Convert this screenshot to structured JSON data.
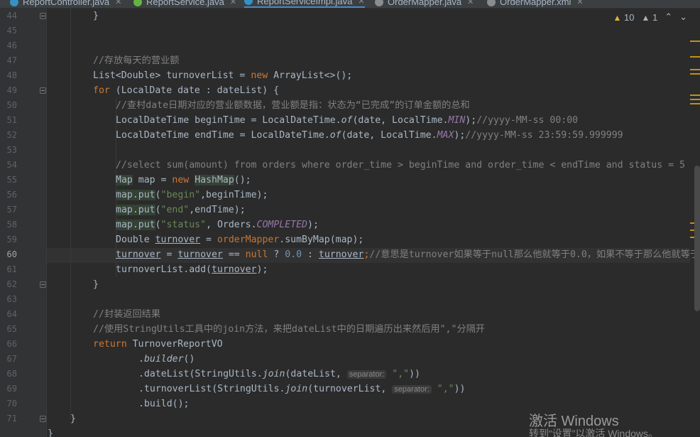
{
  "tabs": [
    {
      "label": "ReportController.java",
      "icon_color": "#3592c4"
    },
    {
      "label": "ReportService.java",
      "icon_color": "#62b543"
    },
    {
      "label": "ReportServiceImpl.java",
      "icon_color": "#3592c4",
      "active": true
    },
    {
      "label": "OrderMapper.java",
      "icon_color": "#8c8c8c"
    },
    {
      "label": "OrderMapper.xml",
      "icon_color": "#8c8c8c"
    }
  ],
  "inspections": {
    "warnings": "10",
    "weak_warnings": "1"
  },
  "line_numbers": [
    "44",
    "45",
    "46",
    "47",
    "48",
    "49",
    "50",
    "51",
    "52",
    "53",
    "54",
    "55",
    "56",
    "57",
    "58",
    "59",
    "60",
    "61",
    "62",
    "63",
    "64",
    "65",
    "66",
    "67",
    "68",
    "69",
    "70",
    "71"
  ],
  "current_line": "60",
  "code": {
    "l44_brace": "}",
    "l47_comment": "//存放每天的营业额",
    "l48_a": "List<Double> turnoverList = ",
    "l48_new": "new",
    "l48_b": " ArrayList<>();",
    "l49_for": "for",
    "l49_b": " (LocalDate date : dateList) {",
    "l50_comment": "//查村date日期对应的营业额数据，营业额是指：状态为“已完成”的订单金额的总和",
    "l51_a": "LocalDateTime beginTime = LocalDateTime.",
    "l51_of": "of",
    "l51_b": "(date, LocalTime.",
    "l51_min": "MIN",
    "l51_c": ");",
    "l51_cm": "//yyyy-MM-ss 00:00",
    "l52_a": "LocalDateTime endTime = LocalDateTime.",
    "l52_of": "of",
    "l52_b": "(date, LocalTime.",
    "l52_max": "MAX",
    "l52_c": ");",
    "l52_cm": "//yyyy-MM-ss 23:59:59.999999",
    "l54_comment": "//select sum(amount) from orders where order_time > beginTime and order_time < endTime and status = 5",
    "l55_map": "Map",
    "l55_a": " map = ",
    "l55_new": "new",
    "l55_sp": " ",
    "l55_hashmap": "HashMap",
    "l55_b": "();",
    "l56_put": "map.put",
    "l56_a": "(",
    "l56_str": "\"begin\"",
    "l56_b": ",beginTime);",
    "l57_put": "map.put",
    "l57_a": "(",
    "l57_str": "\"end\"",
    "l57_b": ",endTime);",
    "l58_put": "map.put",
    "l58_a": "(",
    "l58_str": "\"status\"",
    "l58_b": ", Orders.",
    "l58_completed": "COMPLETED",
    "l58_c": ");",
    "l59_a": "Double ",
    "l59_turnover": "turnover",
    "l59_b": " = ",
    "l59_mapper": "orderMapper",
    "l59_c": ".sumByMap(map);",
    "l60_t1": "turnover",
    "l60_a": " = ",
    "l60_t2": "turnover",
    "l60_b": " == ",
    "l60_null": "null",
    "l60_c": " ? ",
    "l60_zero": "0.0",
    "l60_d": " : ",
    "l60_t3": "turnover",
    "l60_semi": ";",
    "l60_cm": "//意思是turnover如果等于null那么他就等于0.0，如果不等于那么他就等于",
    "l61_a": "turnoverList.add(",
    "l61_turnover": "turnover",
    "l61_b": ");",
    "l62_brace": "}",
    "l64_comment": "//封装返回结果",
    "l65_comment": "//使用StringUtils工具中的join方法，来把dateList中的日期遍历出来然后用\",\"分隔开",
    "l66_return": "return",
    "l66_b": " TurnoverReportVO",
    "l67_dot": ".",
    "l67_builder": "builder",
    "l67_b": "()",
    "l68_a": ".dateList(StringUtils.",
    "l68_join": "join",
    "l68_b": "(dateList, ",
    "l68_hint": "separator:",
    "l68_sp": " ",
    "l68_str": "\",\"",
    "l68_c": "))",
    "l69_a": ".turnoverList(StringUtils.",
    "l69_join": "join",
    "l69_b": "(turnoverList, ",
    "l69_hint": "separator:",
    "l69_sp": " ",
    "l69_str": "\",\"",
    "l69_c": "))",
    "l70_a": ".build();",
    "l71_brace": "}",
    "l72_brace": "}"
  },
  "watermark": {
    "title": "激活 Windows",
    "subtitle": "转到“设置”以激活 Windows。"
  },
  "colors": {
    "background": "#2b2b2b",
    "keyword": "#cc7832",
    "comment": "#808080",
    "string": "#6a8759",
    "number": "#6897bb",
    "constant": "#9876aa",
    "warning": "#be9117"
  }
}
